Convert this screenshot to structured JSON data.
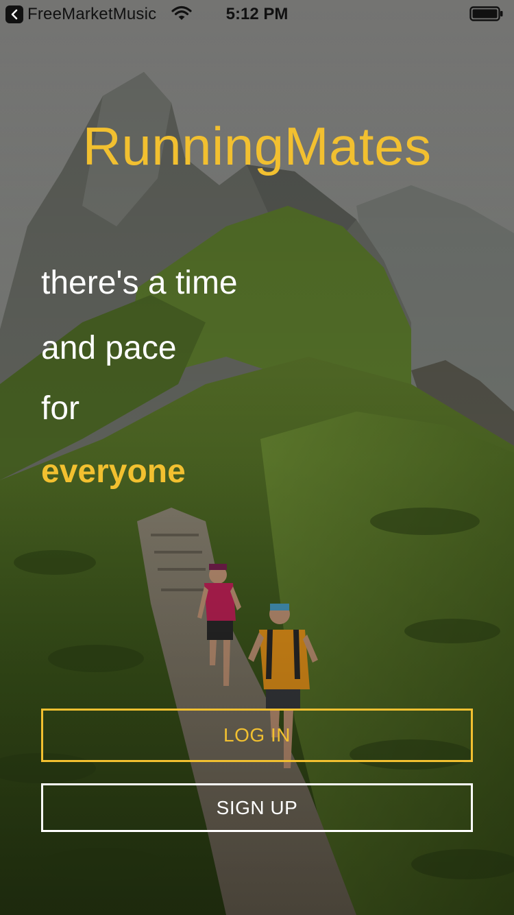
{
  "status_bar": {
    "back_app": "FreeMarketMusic",
    "time": "5:12 PM",
    "icons": [
      "back-arrow-icon",
      "wifi-icon",
      "battery-icon"
    ]
  },
  "hero": {
    "title": "RunningMates",
    "tagline_lines": [
      "there's a time",
      "and pace",
      "for",
      "everyone"
    ]
  },
  "actions": {
    "login_label": "LOG IN",
    "signup_label": "SIGN UP"
  },
  "colors": {
    "accent": "#f2c030",
    "text_light": "#ffffff"
  }
}
